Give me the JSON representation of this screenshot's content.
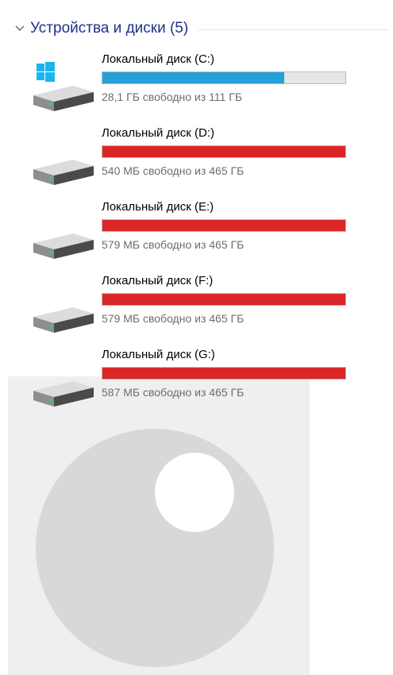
{
  "group": {
    "title": "Устройства и диски (5)",
    "icon": "chevron-down-icon"
  },
  "colors": {
    "normal_bar": "#26a0da",
    "full_bar": "#da2626",
    "bar_track": "#e6e6e6"
  },
  "drives": [
    {
      "name": "Локальный диск (C:)",
      "free_text": "28,1 ГБ свободно из 111 ГБ",
      "used_fraction": 0.747,
      "status": "normal",
      "system": true
    },
    {
      "name": "Локальный диск (D:)",
      "free_text": "540 МБ свободно из 465 ГБ",
      "used_fraction": 0.999,
      "status": "full",
      "system": false
    },
    {
      "name": "Локальный диск (E:)",
      "free_text": "579 МБ свободно из 465 ГБ",
      "used_fraction": 0.999,
      "status": "full",
      "system": false
    },
    {
      "name": "Локальный диск (F:)",
      "free_text": "579 МБ свободно из 465 ГБ",
      "used_fraction": 0.999,
      "status": "full",
      "system": false
    },
    {
      "name": "Локальный диск (G:)",
      "free_text": "587 МБ свободно из 465 ГБ",
      "used_fraction": 0.999,
      "status": "full",
      "system": false
    }
  ]
}
